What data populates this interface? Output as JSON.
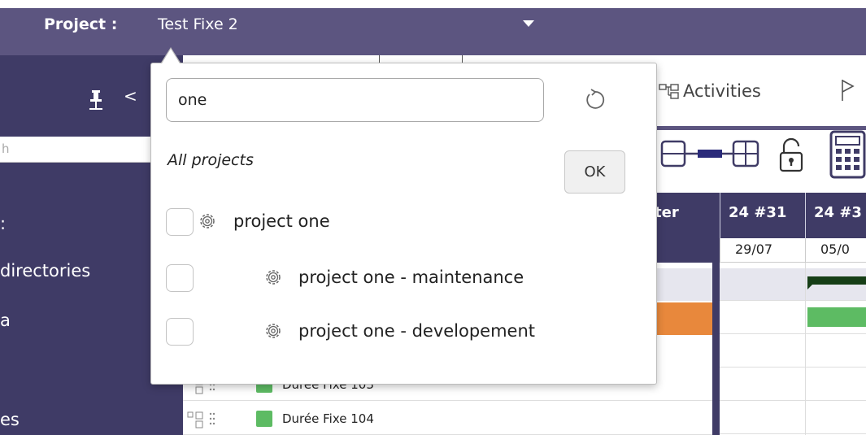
{
  "header": {
    "project_label": "Project :",
    "project_name": "Test Fixe 2"
  },
  "sidebar": {
    "search_placeholder": "h",
    "items": [
      {
        "label": ":"
      },
      {
        "label": "directories"
      },
      {
        "label": "a"
      },
      {
        "label": "es"
      }
    ]
  },
  "toolbar": {
    "activities_label": "Activities"
  },
  "gantt": {
    "column_header": "ter",
    "weeks": [
      {
        "label": "24 #31",
        "date": "29/07"
      },
      {
        "label": "24 #3",
        "date": "05/0"
      }
    ]
  },
  "tasks": [
    {
      "name": "Durée Fixe 103"
    },
    {
      "name": "Durée Fixe 104"
    }
  ],
  "popup": {
    "search_value": "one",
    "all_projects_label": "All projects",
    "ok_label": "OK",
    "projects": [
      {
        "label": "project one",
        "checked": false,
        "level": 0
      },
      {
        "label": "project one - maintenance",
        "checked": false,
        "level": 1
      },
      {
        "label": "project one - developement",
        "checked": false,
        "level": 1
      }
    ]
  },
  "colors": {
    "topbar": "#5c5580",
    "sidebar": "#3f3b66",
    "task_green": "#5dbb63",
    "task_orange": "#e8883c",
    "bar_dark": "#163e16"
  }
}
